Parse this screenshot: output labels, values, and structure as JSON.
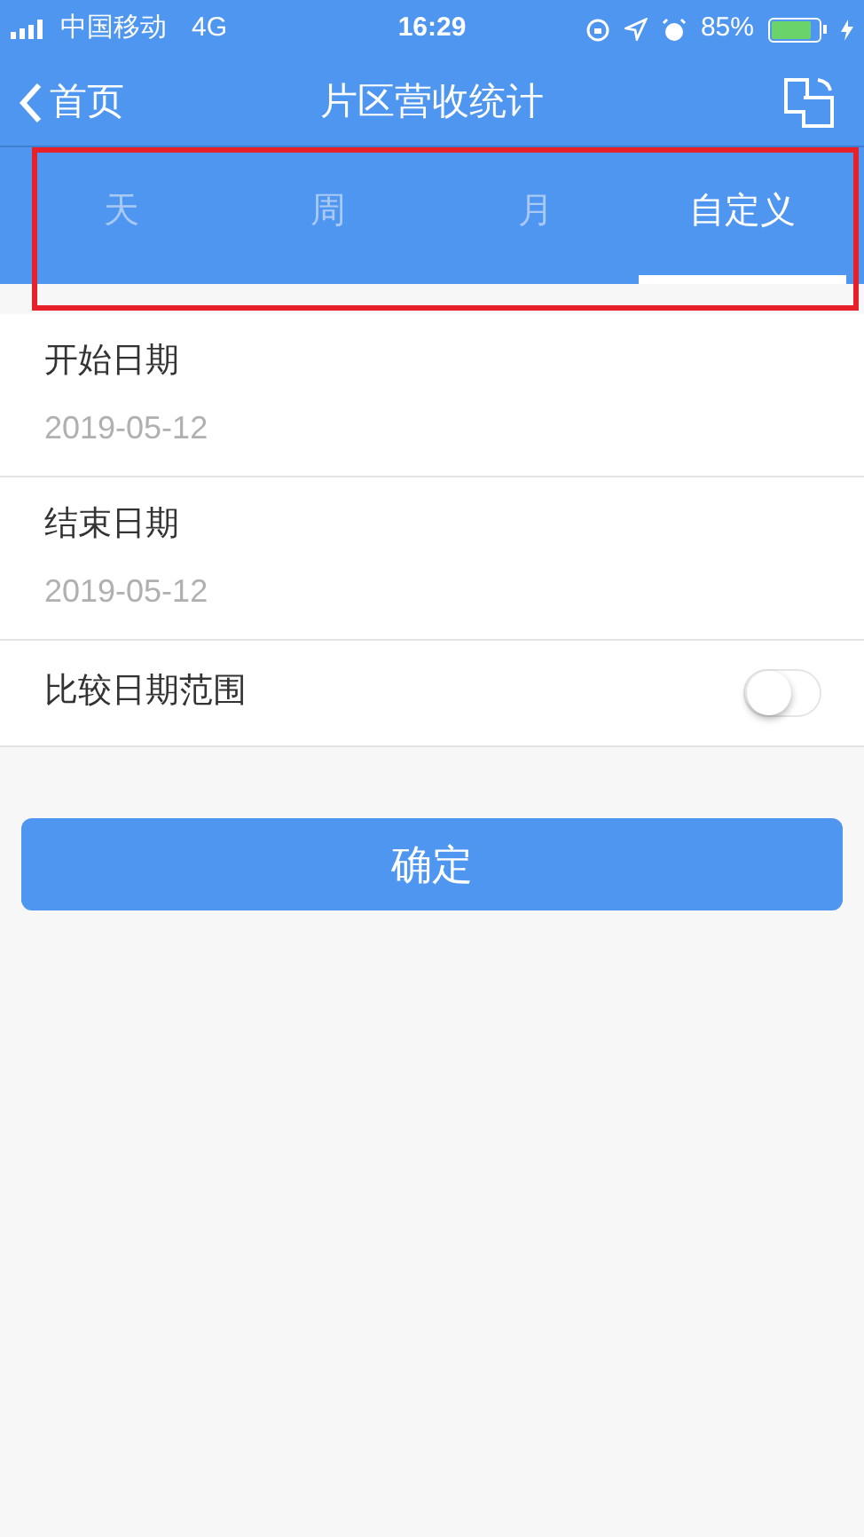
{
  "status_bar": {
    "carrier": "中国移动",
    "network": "4G",
    "time": "16:29",
    "battery": "85%"
  },
  "nav": {
    "back": "首页",
    "title": "片区营收统计"
  },
  "tabs": [
    {
      "label": "天",
      "selected": false
    },
    {
      "label": "周",
      "selected": false
    },
    {
      "label": "月",
      "selected": false
    },
    {
      "label": "自定义",
      "selected": true
    }
  ],
  "fields": [
    {
      "kind": "date",
      "label": "开始日期",
      "value": "2019-05-12"
    },
    {
      "kind": "date",
      "label": "结束日期",
      "value": "2019-05-12"
    },
    {
      "kind": "toggle",
      "label": "比较日期范围",
      "on": false
    }
  ],
  "confirm": "确定"
}
